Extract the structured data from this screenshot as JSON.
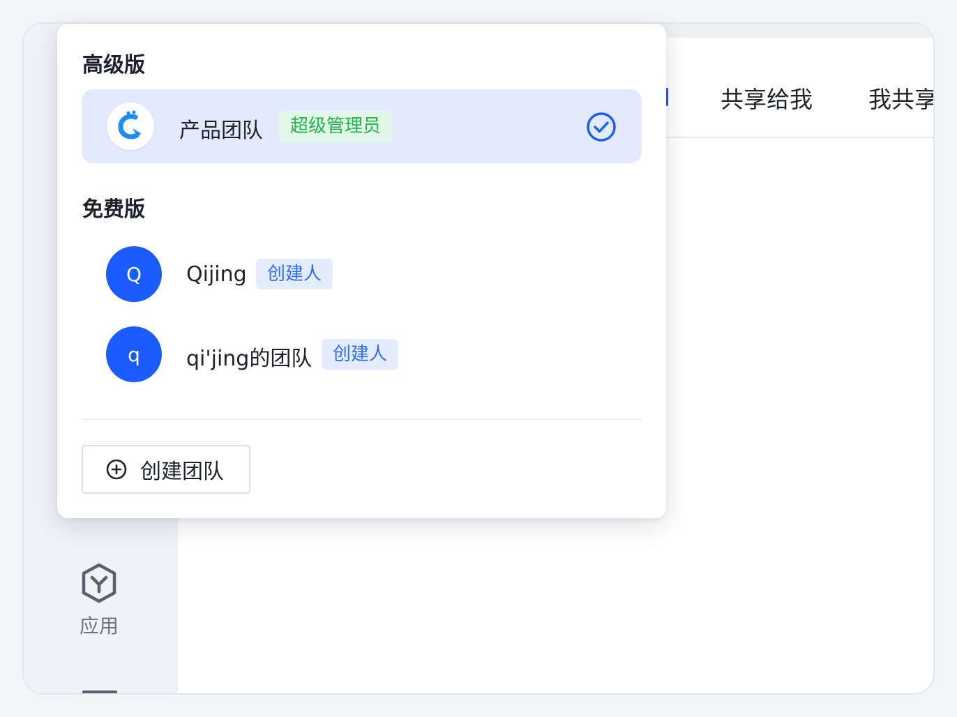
{
  "tabs": {
    "shared_to_me": "共享给我",
    "my_shared": "我共享"
  },
  "sidebar": {
    "app_label": "应用",
    "app_icon": "hexagon-y-icon"
  },
  "dropdown": {
    "premium_section_title": "高级版",
    "free_section_title": "免费版",
    "premium_teams": [
      {
        "name": "产品团队",
        "role": "超级管理员",
        "icon": "team-logo-icon",
        "selected": true
      }
    ],
    "free_teams": [
      {
        "avatar_letter": "Q",
        "name": "Qijing",
        "role": "创建人"
      },
      {
        "avatar_letter": "q",
        "name": "qi'jing的团队",
        "role": "创建人"
      }
    ],
    "create_button_label": "创建团队",
    "create_button_icon": "plus-circle-icon"
  },
  "colors": {
    "accent": "#1b5cff",
    "selected_bg": "#e2ebfd",
    "admin_badge_text": "#1fb54a",
    "admin_badge_bg": "#e3f7e8",
    "creator_badge_text": "#2f6df6",
    "creator_badge_bg": "#e4edfd"
  }
}
